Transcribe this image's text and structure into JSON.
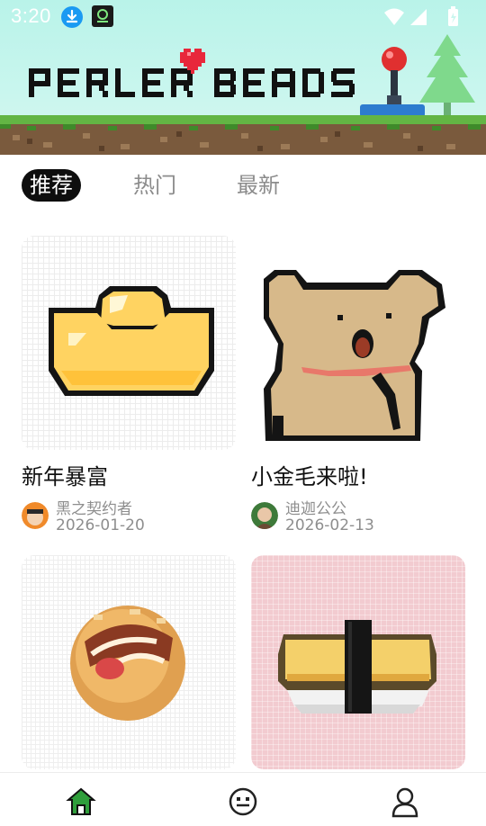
{
  "status_bar": {
    "time": "3:20"
  },
  "banner": {
    "title_left": "PERLER",
    "title_right": "BEADS"
  },
  "tabs": [
    {
      "label": "推荐",
      "active": true
    },
    {
      "label": "热门",
      "active": false
    },
    {
      "label": "最新",
      "active": false
    }
  ],
  "cards": [
    {
      "title": "新年暴富",
      "author": "黑之契约者",
      "date": "2026-01-20",
      "image": "gold-ingot-pixel-art"
    },
    {
      "title": "小金毛来啦!",
      "author": "迪迦公公",
      "date": "2026-02-13",
      "image": "bear-pixel-art"
    },
    {
      "title": "",
      "author": "",
      "date": "",
      "image": "takoyaki-pixel-art"
    },
    {
      "title": "",
      "author": "",
      "date": "",
      "image": "sushi-pixel-art"
    }
  ],
  "bottom_nav": [
    {
      "icon": "home-icon",
      "active": true
    },
    {
      "icon": "face-icon",
      "active": false
    },
    {
      "icon": "profile-icon",
      "active": false
    }
  ],
  "colors": {
    "accent_green": "#2f9e3b",
    "tab_active_bg": "#0e0e0e",
    "muted_text": "#8e8e8e"
  }
}
